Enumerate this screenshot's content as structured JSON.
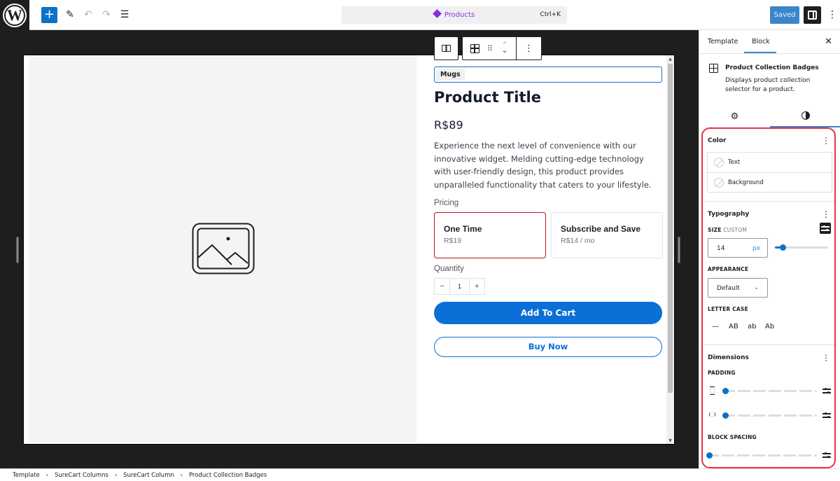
{
  "topbar": {
    "logo": "W",
    "add_label": "+",
    "tools": [
      {
        "icon": "pencil-icon",
        "glyph": "✎"
      },
      {
        "icon": "undo-icon",
        "glyph": "↶"
      },
      {
        "icon": "redo-icon",
        "glyph": "↷"
      },
      {
        "icon": "document-overview-icon",
        "glyph": "☰"
      }
    ],
    "command": {
      "title": "Products",
      "shortcut": "Ctrl+K"
    },
    "saved_label": "Saved",
    "more": "⋮"
  },
  "block_toolbar": {
    "drag": "⠿",
    "up": "⌃",
    "down": "⌄",
    "more": "⋮"
  },
  "product": {
    "badge": "Mugs",
    "title": "Product Title",
    "price": "R$89",
    "description": "Experience the next level of convenience with our innovative widget. Melding cutting-edge technology with user-friendly design, this product provides unparalleled functionality that caters to your lifestyle.",
    "pricing_label": "Pricing",
    "prices": [
      {
        "name": "One Time",
        "amount": "R$19",
        "selected": true
      },
      {
        "name": "Subscribe and Save",
        "amount": "R$14 / mo",
        "selected": false
      }
    ],
    "quantity_label": "Quantity",
    "quantity": {
      "minus": "−",
      "value": "1",
      "plus": "+"
    },
    "add_to_cart": "Add To Cart",
    "buy_now": "Buy Now"
  },
  "sidebar": {
    "tabs": [
      "Template",
      "Block"
    ],
    "active_tab": "Block",
    "close": "✕",
    "block": {
      "title": "Product Collection Badges",
      "description": "Displays product collection selector for a product."
    },
    "subtabs": {
      "settings": "⚙",
      "styles_active": true
    },
    "color": {
      "title": "Color",
      "items": [
        "Text",
        "Background"
      ]
    },
    "typography": {
      "title": "Typography",
      "size_label": "SIZE",
      "size_mode": "CUSTOM",
      "size_value": "14",
      "size_unit": "px",
      "size_slider_fraction": 0.15,
      "appearance_label": "APPEARANCE",
      "appearance_value": "Default",
      "letter_case_label": "LETTER CASE",
      "letter_case_options": [
        "—",
        "AB",
        "ab",
        "Ab"
      ]
    },
    "dimensions": {
      "title": "Dimensions",
      "padding_label": "PADDING",
      "padding_vertical_value": 0,
      "padding_horizontal_value": 0,
      "block_spacing_label": "BLOCK SPACING",
      "block_spacing_value": 0
    },
    "section_more": "⋮"
  },
  "breadcrumb": [
    "Template",
    "SureCart Columns",
    "SureCart Column",
    "Product Collection Badges"
  ],
  "colors": {
    "accent": "#0b73c7",
    "highlight": "#e8304a",
    "selected_price_border": "#b4131b",
    "command_title": "#8a2ce0"
  }
}
